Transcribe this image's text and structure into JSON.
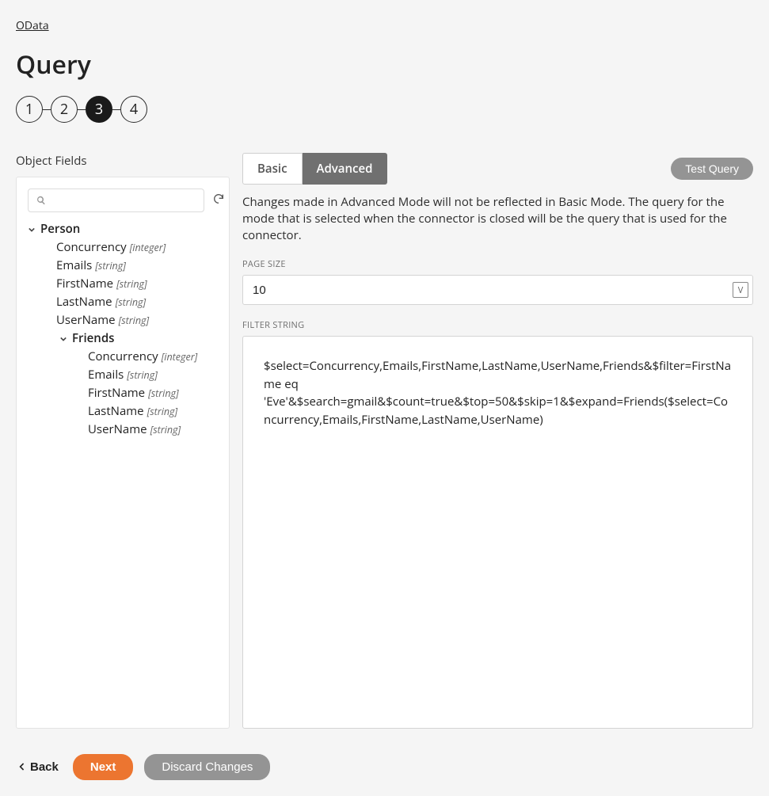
{
  "breadcrumb": {
    "label": "OData"
  },
  "page": {
    "title": "Query"
  },
  "stepper": {
    "steps": [
      "1",
      "2",
      "3",
      "4"
    ],
    "active_index": 2
  },
  "left": {
    "heading": "Object Fields",
    "search_placeholder": "",
    "tree": {
      "root": {
        "label": "Person"
      },
      "fields": [
        {
          "name": "Concurrency",
          "type": "[integer]"
        },
        {
          "name": "Emails",
          "type": "[string]"
        },
        {
          "name": "FirstName",
          "type": "[string]"
        },
        {
          "name": "LastName",
          "type": "[string]"
        },
        {
          "name": "UserName",
          "type": "[string]"
        }
      ],
      "child": {
        "label": "Friends",
        "fields": [
          {
            "name": "Concurrency",
            "type": "[integer]"
          },
          {
            "name": "Emails",
            "type": "[string]"
          },
          {
            "name": "FirstName",
            "type": "[string]"
          },
          {
            "name": "LastName",
            "type": "[string]"
          },
          {
            "name": "UserName",
            "type": "[string]"
          }
        ]
      }
    }
  },
  "right": {
    "tabs": {
      "basic": "Basic",
      "advanced": "Advanced"
    },
    "test_btn": "Test Query",
    "notice": "Changes made in Advanced Mode will not be reflected in Basic Mode. The query for the mode that is selected when the connector is closed will be the query that is used for the connector.",
    "page_size": {
      "label": "PAGE SIZE",
      "value": "10",
      "var_icon": "V"
    },
    "filter": {
      "label": "FILTER STRING",
      "value": "$select=Concurrency,Emails,FirstName,LastName,UserName,Friends&$filter=FirstName eq 'Eve'&$search=gmail&$count=true&$top=50&$skip=1&$expand=Friends($select=Concurrency,Emails,FirstName,LastName,UserName)"
    }
  },
  "footer": {
    "back": "Back",
    "next": "Next",
    "discard": "Discard Changes"
  }
}
